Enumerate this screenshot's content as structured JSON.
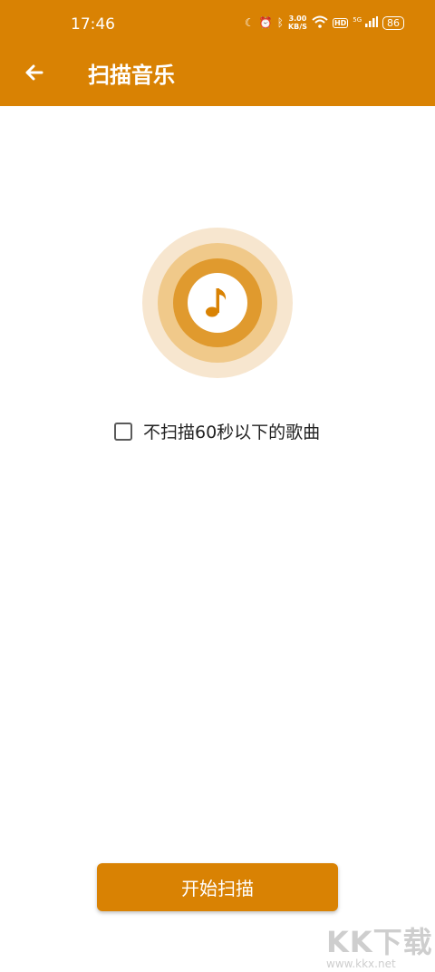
{
  "status_bar": {
    "time": "17:46",
    "speed_value": "3.00",
    "speed_unit": "KB/S",
    "hd_label": "HD",
    "network_label": "5G",
    "battery_level": "86"
  },
  "app_bar": {
    "title": "扫描音乐",
    "back_icon": "arrow-left-icon"
  },
  "scan_graphic": {
    "icon": "music-note-icon",
    "colors": {
      "outer": "#f7e6cf",
      "middle": "#f0c98a",
      "inner": "#e09a2e",
      "core": "#ffffff",
      "note": "#d98203"
    }
  },
  "options": {
    "skip_short_label": "不扫描60秒以下的歌曲",
    "skip_short_checked": false
  },
  "actions": {
    "start_label": "开始扫描"
  },
  "watermark": {
    "brand": "KK下载",
    "url": "www.kkx.net"
  },
  "colors": {
    "accent": "#d98203"
  }
}
